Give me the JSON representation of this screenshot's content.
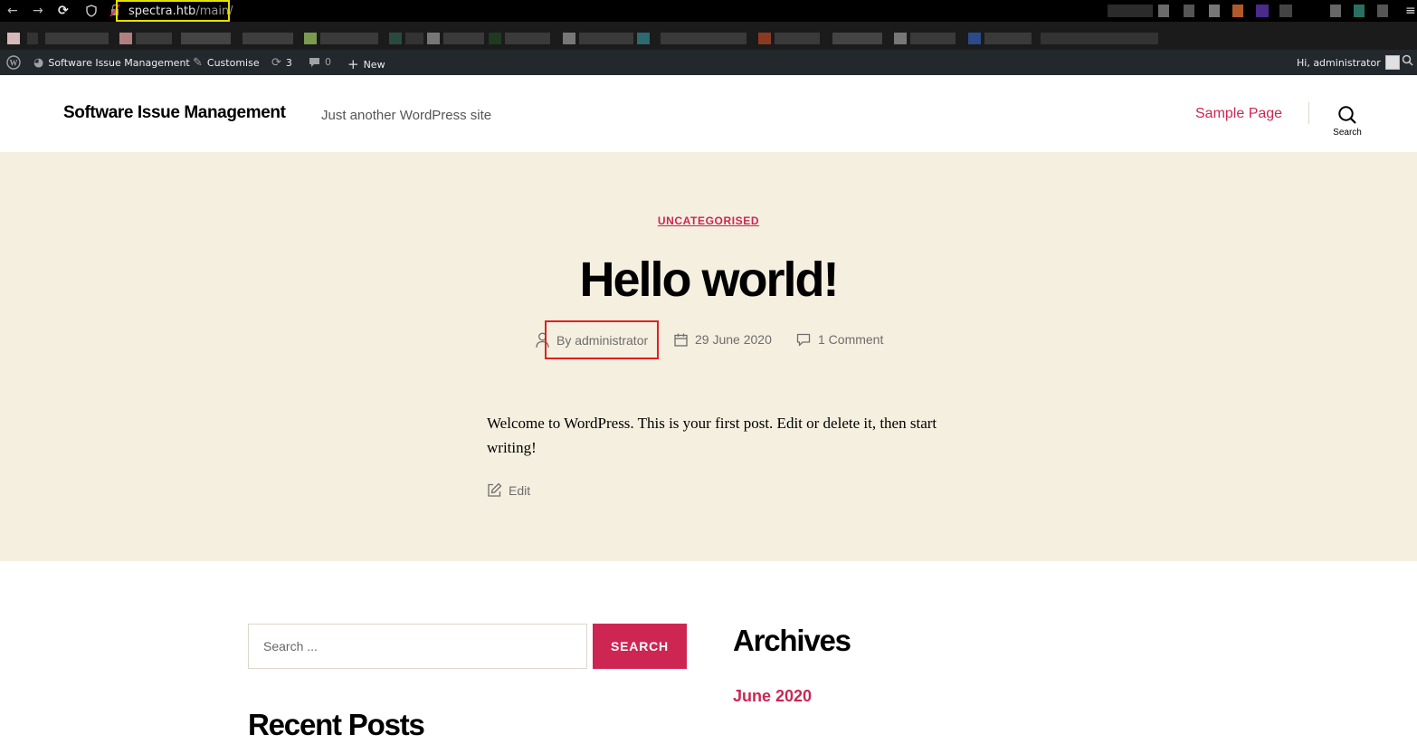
{
  "browser": {
    "url_host": "spectra.htb",
    "url_path": "/main/"
  },
  "admin_bar": {
    "site_name": "Software Issue Management",
    "customise": "Customise",
    "updates_count": "3",
    "comments_count": "0",
    "new": "New",
    "greeting": "Hi, administrator"
  },
  "header": {
    "site_title": "Software Issue Management",
    "site_description": "Just another WordPress site",
    "menu_item": "Sample Page",
    "search_label": "Search"
  },
  "post": {
    "category": "UNCATEGORISED",
    "title": "Hello world!",
    "author": "By administrator",
    "date": "29 June 2020",
    "comments": "1 Comment",
    "content": "Welcome to WordPress. This is your first post. Edit or delete it, then start writing!",
    "edit": "Edit"
  },
  "widgets": {
    "search_placeholder": "Search ...",
    "search_button": "SEARCH",
    "recent_posts_heading": "Recent Posts",
    "archives_heading": "Archives",
    "archive_item": "June 2020"
  },
  "colors": {
    "accent": "#cd2653",
    "hero_bg": "#f5efe0",
    "admin_bar_bg": "#23282d"
  }
}
